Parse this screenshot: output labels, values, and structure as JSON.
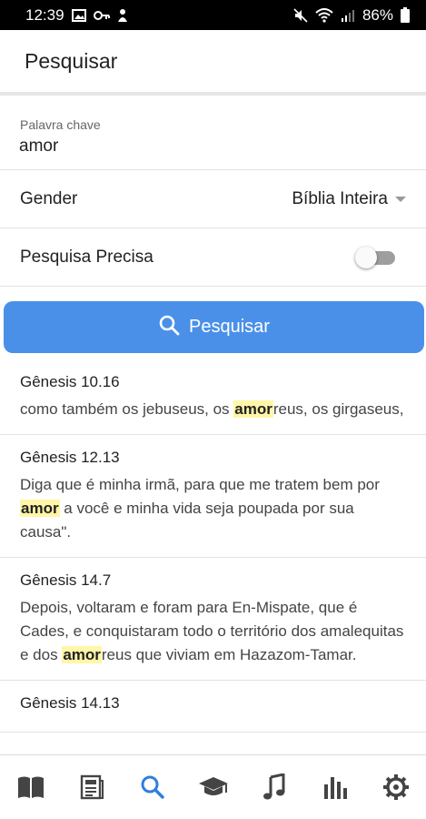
{
  "status_bar": {
    "time": "12:39",
    "battery": "86%"
  },
  "app_bar": {
    "title": "Pesquisar"
  },
  "keyword": {
    "label": "Palavra chave",
    "value": "amor"
  },
  "gender": {
    "label": "Gender",
    "selected": "Bíblia Inteira"
  },
  "precise": {
    "label": "Pesquisa Precisa",
    "enabled": false
  },
  "search_button": {
    "label": "Pesquisar"
  },
  "results": [
    {
      "ref": "Gênesis 10.16",
      "before": "como também os jebuseus, os ",
      "highlight": "amor",
      "after": "reus, os girgaseus,"
    },
    {
      "ref": "Gênesis 12.13",
      "before": "Diga que é minha irmã, para que me tratem bem por ",
      "highlight": "amor",
      "after": " a você e minha vida seja poupada por sua causa\"."
    },
    {
      "ref": "Gênesis 14.7",
      "before": "Depois, voltaram e foram para En-Mispate, que é Cades, e conquistaram todo o território dos amalequitas e dos ",
      "highlight": "amor",
      "after": "reus que viviam em Hazazom-Tamar."
    },
    {
      "ref": "Gênesis 14.13",
      "before": "",
      "highlight": "",
      "after": ""
    }
  ],
  "bottom_nav": [
    {
      "icon": "book-icon",
      "active": false
    },
    {
      "icon": "newspaper-icon",
      "active": false
    },
    {
      "icon": "search-icon",
      "active": true
    },
    {
      "icon": "graduation-cap-icon",
      "active": false
    },
    {
      "icon": "music-note-icon",
      "active": false
    },
    {
      "icon": "bar-chart-icon",
      "active": false
    },
    {
      "icon": "settings-gear-icon",
      "active": false
    }
  ],
  "colors": {
    "accent": "#4a90e8",
    "highlight": "#fff6a8",
    "nav_inactive": "#444444",
    "nav_active": "#2f7de1"
  }
}
